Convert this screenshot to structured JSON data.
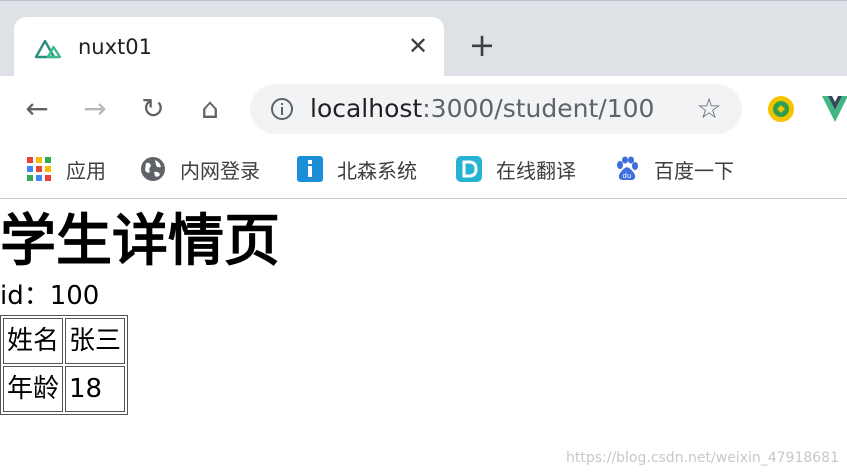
{
  "browser": {
    "tab": {
      "title": "nuxt01",
      "favicon": "nuxt-triangle-icon",
      "close_glyph": "✕"
    },
    "new_tab_glyph": "+",
    "toolbar": {
      "back_glyph": "←",
      "forward_glyph": "→",
      "reload_glyph": "↻",
      "home_glyph": "⌂",
      "star_glyph": "☆"
    },
    "address": {
      "host": "localhost",
      "rest": ":3000/student/100"
    },
    "bookmarks": [
      {
        "label": "应用",
        "icon": "apps-grid-icon"
      },
      {
        "label": "内网登录",
        "icon": "globe-icon"
      },
      {
        "label": "北森系统",
        "icon": "info-i-icon"
      },
      {
        "label": "在线翻译",
        "icon": "translate-d-icon"
      },
      {
        "label": "百度一下",
        "icon": "baidu-paw-icon"
      }
    ]
  },
  "page": {
    "title": "学生详情页",
    "id_line": "id：100",
    "table": {
      "rows": [
        {
          "label": "姓名",
          "value": "张三"
        },
        {
          "label": "年龄",
          "value": "18"
        }
      ]
    }
  },
  "watermark": "https://blog.csdn.net/weixin_47918681"
}
